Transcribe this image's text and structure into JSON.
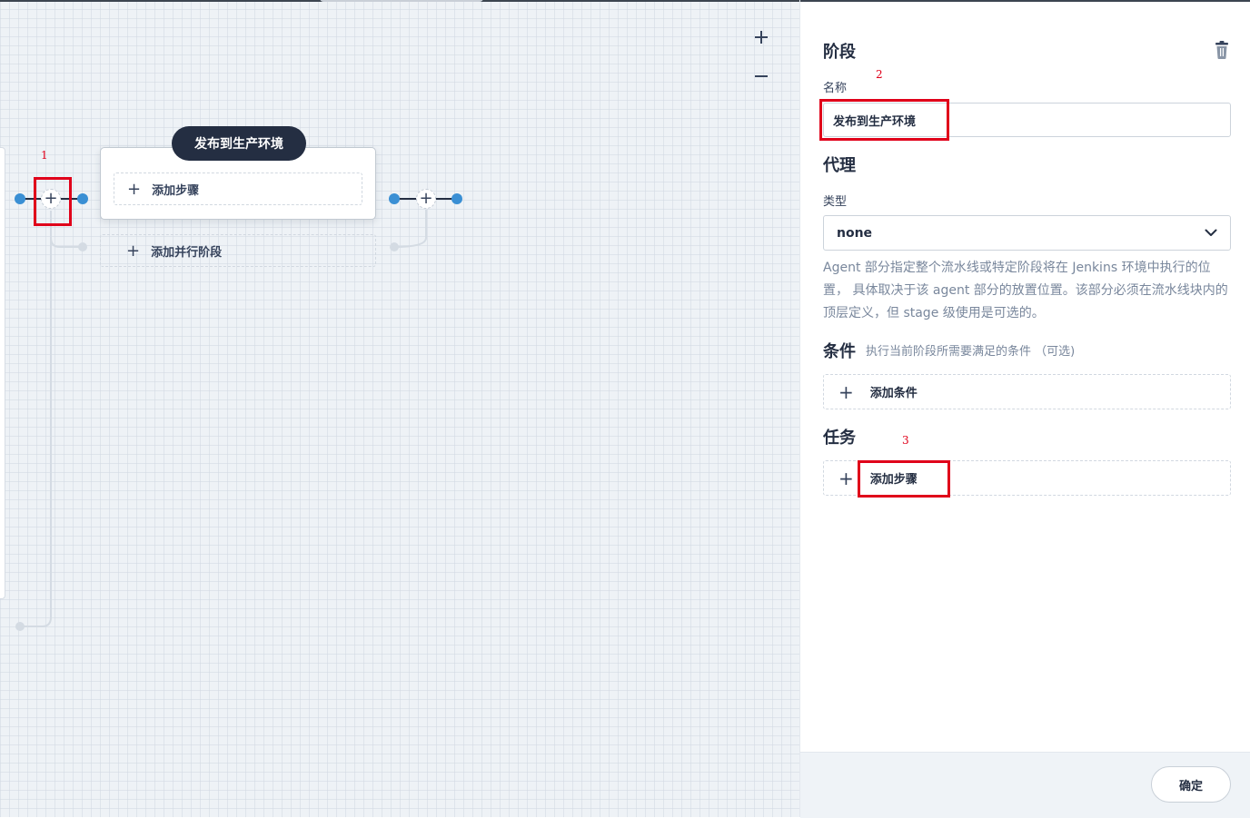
{
  "canvas": {
    "zoom_in_label": "+",
    "zoom_out_label": "−",
    "stage": {
      "name": "发布到生产环境",
      "add_step_label": "添加步骤"
    },
    "add_parallel_label": "添加并行阶段",
    "add_node_glyph": "+",
    "annotations": {
      "one": "1"
    }
  },
  "panel": {
    "section_stage": "阶段",
    "name_label": "名称",
    "name_value": "发布到生产环境",
    "section_agent": "代理",
    "type_label": "类型",
    "type_value": "none",
    "agent_description": "Agent 部分指定整个流水线或特定阶段将在 Jenkins 环境中执行的位置， 具体取决于该 agent 部分的放置位置。该部分必须在流水线块内的顶层定义，但 stage 级使用是可选的。",
    "section_condition": "条件",
    "condition_hint": "执行当前阶段所需要满足的条件 （可选)",
    "add_condition_label": "添加条件",
    "section_tasks": "任务",
    "add_step_label": "添加步骤",
    "confirm_label": "确定",
    "annotations": {
      "two": "2",
      "three": "3"
    }
  },
  "colors": {
    "dark": "#242e42",
    "accent_blue": "#3a8fd4",
    "annotation_red": "#e0001a",
    "canvas_bg": "#eef2f6"
  },
  "icons": [
    "plus-icon",
    "minus-icon",
    "trash-icon",
    "chevron-down-icon"
  ]
}
